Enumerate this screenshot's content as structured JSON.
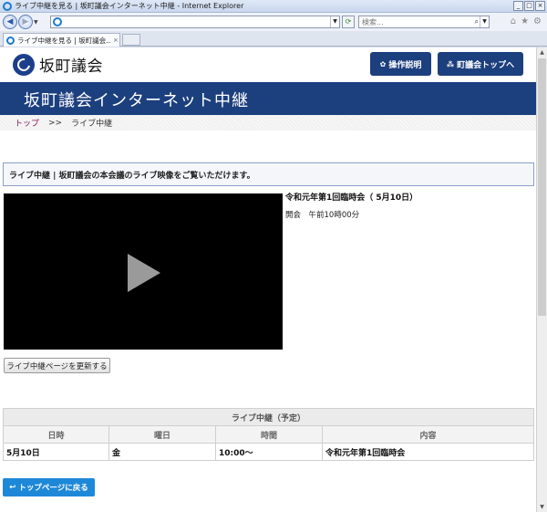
{
  "window": {
    "title": "ライブ中継を見る | 坂町議会インターネット中継 - Internet Explorer",
    "controls": [
      "_",
      "□",
      "×"
    ]
  },
  "browser": {
    "search_placeholder": "検索...",
    "tab_label": "ライブ中継を見る | 坂町議会...",
    "tab_close": "×"
  },
  "header": {
    "logo_text": "坂町議会",
    "ops_button": "操作説明",
    "top_button": "町議会トップへ"
  },
  "banner": {
    "title": "坂町議会インターネット中継"
  },
  "breadcrumb": {
    "home": "トップ",
    "separator": ">>",
    "current": "ライブ中継"
  },
  "notice": {
    "text": "ライブ中継 | 坂町議会の本会議のライブ映像をご覧いただけます。"
  },
  "session": {
    "title": "令和元年第1回臨時会（ 5月10日）",
    "time": "開会　午前10時00分"
  },
  "refresh_button": "ライブ中継ページを更新する",
  "schedule": {
    "caption": "ライブ中継（予定）",
    "columns": [
      "日時",
      "曜日",
      "時間",
      "内容"
    ],
    "rows": [
      [
        "5月10日",
        "金",
        "10:00～",
        "令和元年第1回臨時会"
      ]
    ]
  },
  "back_button": "トップページに戻る"
}
